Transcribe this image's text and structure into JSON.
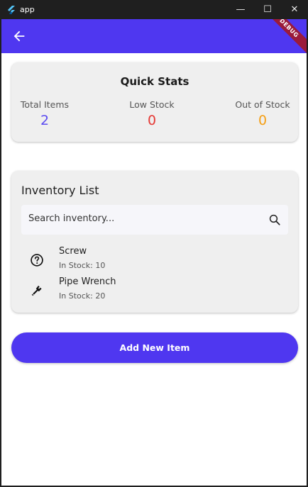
{
  "window": {
    "title": "app",
    "controls": {
      "minimize": "—",
      "maximize": "☐",
      "close": "✕"
    }
  },
  "appbar": {
    "debug_banner": "DEBUG",
    "back_icon": "arrow-left-icon",
    "color": "#4f37f0"
  },
  "quick_stats": {
    "title": "Quick Stats",
    "items": [
      {
        "label": "Total Items",
        "value": "2",
        "color": "#5b4bf0"
      },
      {
        "label": "Low Stock",
        "value": "0",
        "color": "#e53935"
      },
      {
        "label": "Out of Stock",
        "value": "0",
        "color": "#f59f14"
      }
    ]
  },
  "inventory": {
    "title": "Inventory List",
    "search": {
      "placeholder": "Search inventory...",
      "icon": "search-icon"
    },
    "items": [
      {
        "name": "Screw",
        "stock": "In Stock: 10",
        "icon": "help-circle-icon"
      },
      {
        "name": "Pipe Wrench",
        "stock": "In Stock: 20",
        "icon": "wrench-icon"
      }
    ]
  },
  "actions": {
    "add_new_item": "Add New Item"
  }
}
